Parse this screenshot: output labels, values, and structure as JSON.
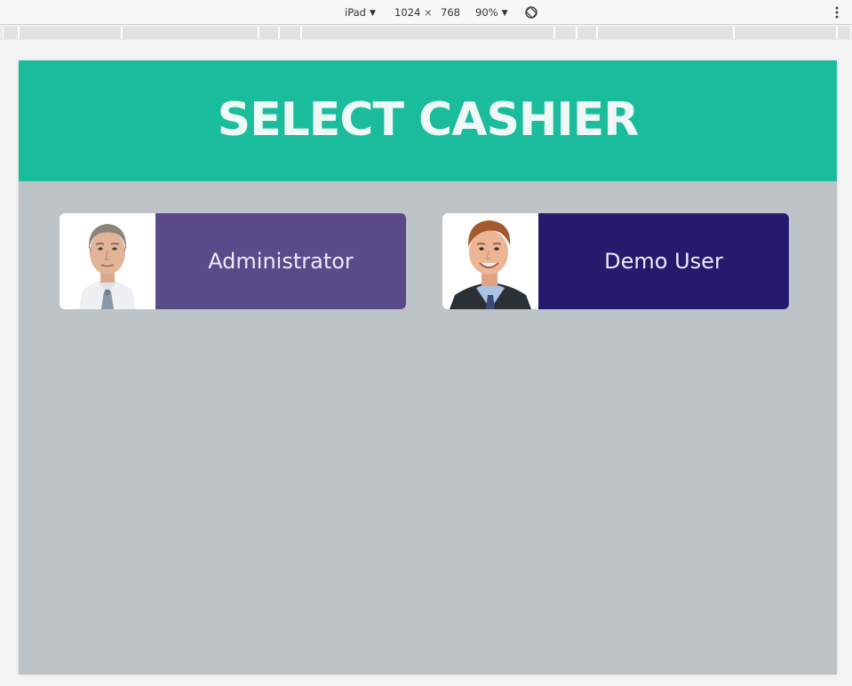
{
  "toolbar": {
    "device": "iPad",
    "width": "1024",
    "times": "×",
    "height": "768",
    "zoom": "90%",
    "dropdown_arrow": "▼",
    "icons": [
      "rotate-icon",
      "more-vert-icon"
    ]
  },
  "header": {
    "title": "SELECT CASHIER",
    "color": "#1abc9c"
  },
  "background_color": "#bdc3c7",
  "cashiers": [
    {
      "name": "Administrator",
      "color": "#5a4a8a",
      "avatar": "administrator-avatar"
    },
    {
      "name": "Demo User",
      "color": "#261a6e",
      "avatar": "demo-user-avatar"
    }
  ]
}
